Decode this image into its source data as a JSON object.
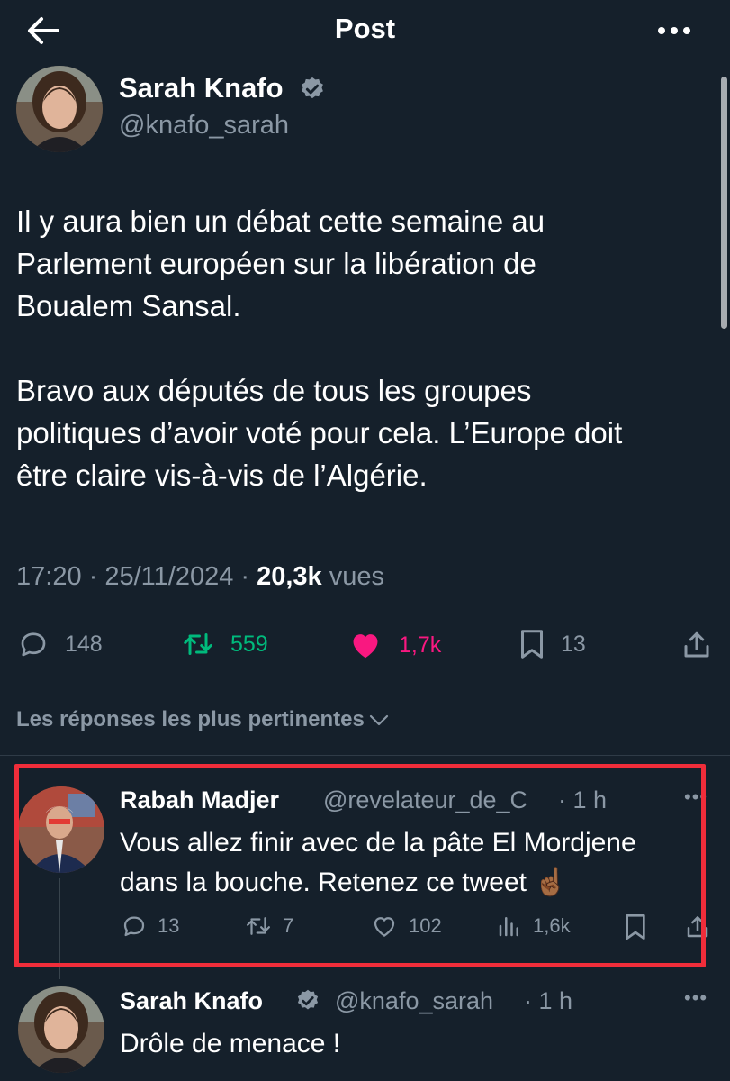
{
  "header": {
    "title": "Post"
  },
  "tweet": {
    "author": {
      "name": "Sarah Knafo",
      "handle": "@knafo_sarah"
    },
    "text_lines_p1": [
      "Il y aura bien un débat cette semaine au",
      "Parlement européen sur la libération de",
      "Boualem Sansal."
    ],
    "text_lines_p2": [
      "Bravo aux députés de tous les groupes",
      "politiques d’avoir voté pour cela. L’Europe doit",
      "être claire vis-à-vis de l’Algérie."
    ],
    "time": "17:20 · 25/11/2024 · ",
    "views_count": "20,3k",
    "views_label": " vues",
    "stats": {
      "replies": "148",
      "retweets": "559",
      "likes": "1,7k",
      "bookmarks": "13"
    }
  },
  "replies_section": {
    "sort_label": "Les réponses les plus pertinentes"
  },
  "replies": [
    {
      "name": "Rabah Madjer",
      "handle": "@revelateur_de_C",
      "time": "· 1 h",
      "text_line1": "Vous allez finir avec de la pâte El Mordjene",
      "text_line2": "dans la bouche. Retenez ce tweet ☝🏾",
      "stats": {
        "replies": "13",
        "retweets": "7",
        "likes": "102",
        "views": "1,6k"
      }
    },
    {
      "name": "Sarah Knafo",
      "handle": "@knafo_sarah",
      "time": "· 1 h",
      "text_line1": "Drôle de menace !"
    }
  ],
  "colors": {
    "background": "#15202b",
    "text": "#ffffff",
    "muted": "#8b98a5",
    "retweet_green": "#00ba7c",
    "like_pink": "#f91880",
    "verified_blue": "#8b98a5",
    "highlight_red": "#f02d3a"
  },
  "icons": [
    "back-arrow-icon",
    "more-icon",
    "verified-icon",
    "reply-icon",
    "retweet-icon",
    "heart-icon",
    "bookmark-icon",
    "share-icon",
    "chevron-down-icon",
    "views-icon"
  ]
}
